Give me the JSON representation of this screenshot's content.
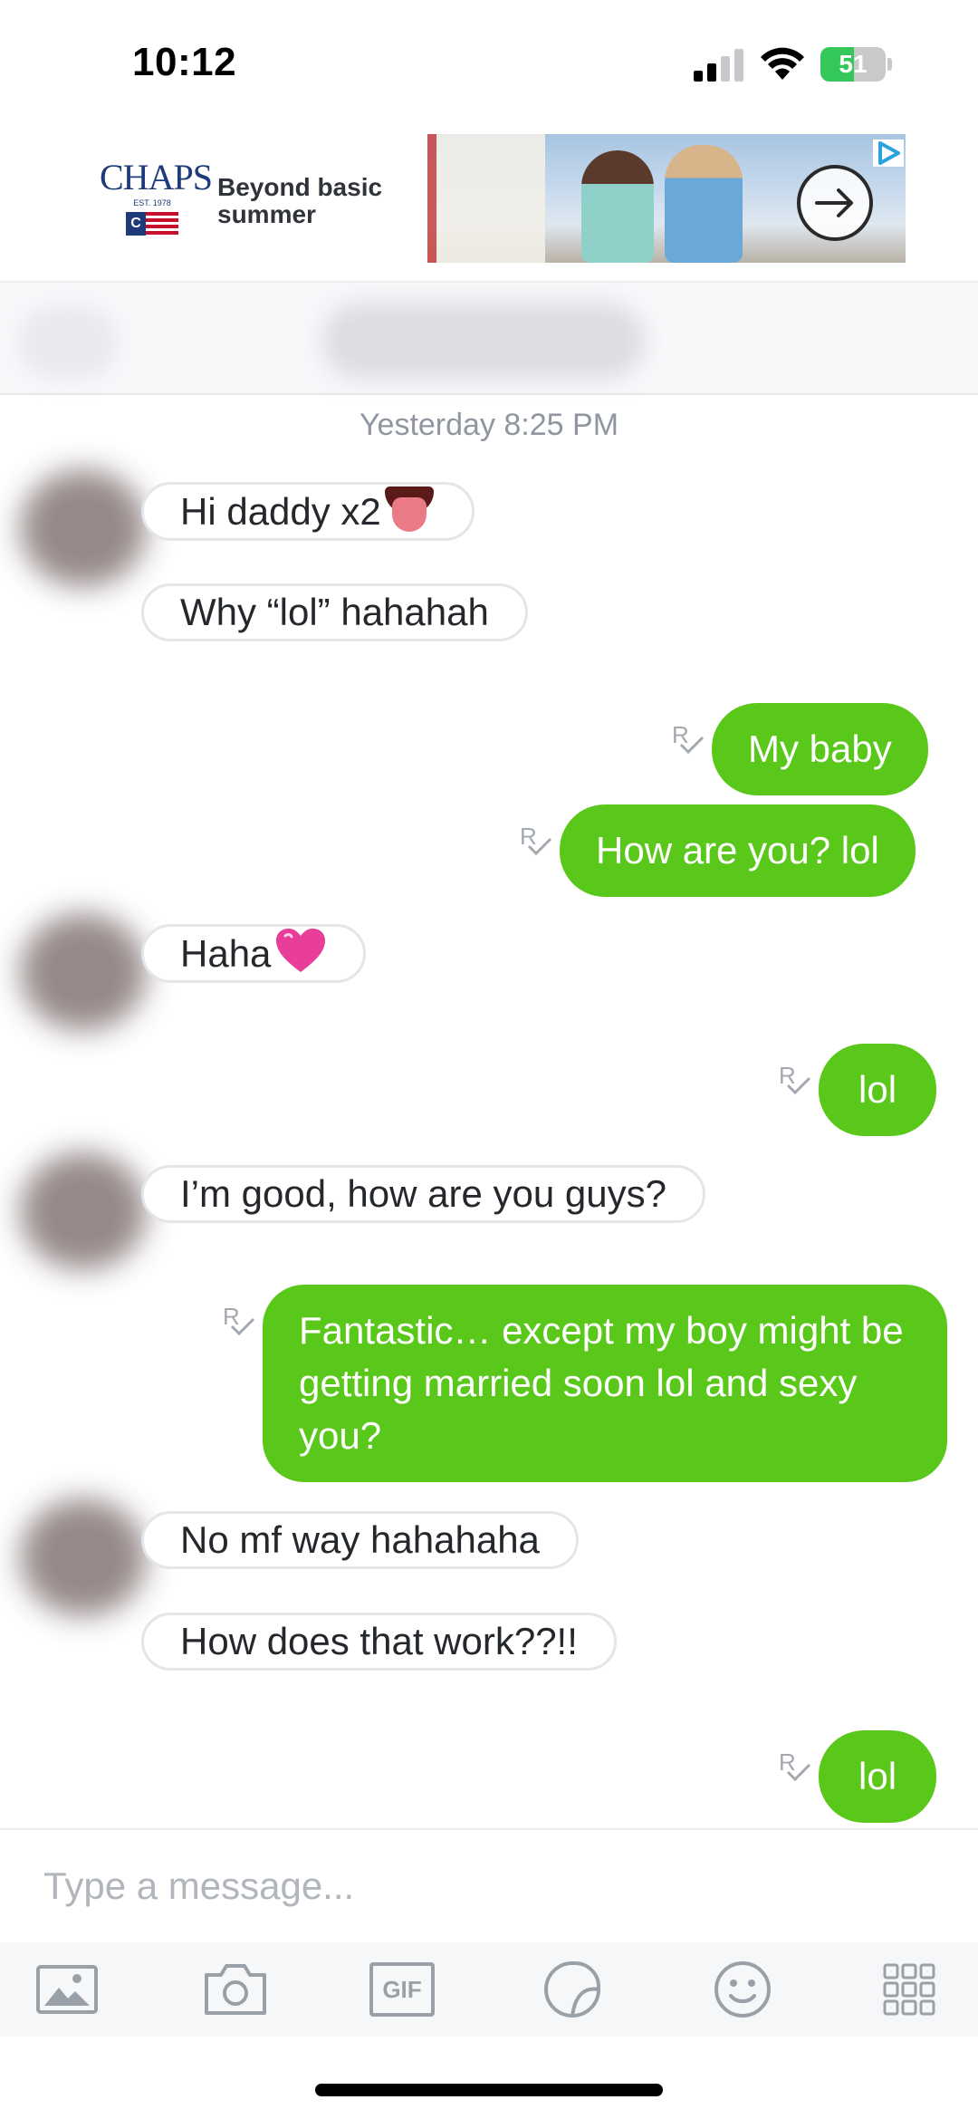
{
  "status_bar": {
    "time": "10:12",
    "battery_percent": "51",
    "battery_level": 0.51,
    "charging": true,
    "signal_bars": 2,
    "accent_color": "#34c759"
  },
  "ad": {
    "brand": "CHAPS",
    "brand_est": "EST. 1978",
    "brand_flag_letter": "C",
    "tagline": "Beyond basic summer",
    "arrow_icon": "arrow-right-icon",
    "choice_icon": "adchoices-icon"
  },
  "conversation": {
    "timestamp": "Yesterday 8:25 PM",
    "read_marker": "R",
    "messages": [
      {
        "direction": "in",
        "text": "Hi daddy x2",
        "emoji": "tongue-emoji"
      },
      {
        "direction": "in",
        "text": "Why “lol” hahahah"
      },
      {
        "direction": "out",
        "text": "My baby"
      },
      {
        "direction": "out",
        "text": "How are you? lol"
      },
      {
        "direction": "in",
        "text": "Haha",
        "emoji": "heart-emoji"
      },
      {
        "direction": "out",
        "text": "lol"
      },
      {
        "direction": "in",
        "text": "I’m good, how are you guys?"
      },
      {
        "direction": "out",
        "text": "Fantastic… except my boy might be getting married soon lol and sexy you?"
      },
      {
        "direction": "in",
        "text": "No mf way hahahaha"
      },
      {
        "direction": "in",
        "text": "How does that work??!!"
      },
      {
        "direction": "out",
        "text": "lol"
      }
    ],
    "outgoing_color": "#5ac81a",
    "incoming_border_color": "#e3e5e9"
  },
  "composer": {
    "placeholder": "Type a message...",
    "value": ""
  },
  "toolbar": {
    "items": [
      {
        "icon": "image-icon"
      },
      {
        "icon": "camera-icon"
      },
      {
        "icon": "gif-icon",
        "label": "GIF"
      },
      {
        "icon": "sticker-icon"
      },
      {
        "icon": "emoji-icon"
      },
      {
        "icon": "more-grid-icon"
      }
    ]
  }
}
